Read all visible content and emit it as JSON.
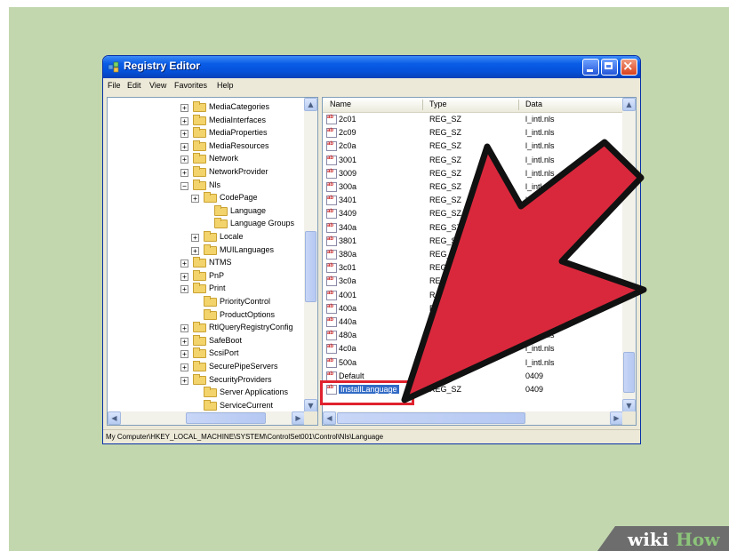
{
  "window": {
    "title": "Registry Editor",
    "menu": [
      "File",
      "Edit",
      "View",
      "Favorites",
      "Help"
    ]
  },
  "tree": {
    "items": [
      {
        "label": "MediaCategories",
        "expander": "+"
      },
      {
        "label": "MediaInterfaces",
        "expander": "+"
      },
      {
        "label": "MediaProperties",
        "expander": "+"
      },
      {
        "label": "MediaResources",
        "expander": "+"
      },
      {
        "label": "Network",
        "expander": "+"
      },
      {
        "label": "NetworkProvider",
        "expander": "+"
      },
      {
        "label": "Nls",
        "expander": "−"
      },
      {
        "label": "CodePage",
        "expander": "+"
      },
      {
        "label": "Language",
        "expander": ""
      },
      {
        "label": "Language Groups",
        "expander": ""
      },
      {
        "label": "Locale",
        "expander": "+"
      },
      {
        "label": "MUILanguages",
        "expander": "+"
      },
      {
        "label": "NTMS",
        "expander": "+"
      },
      {
        "label": "PnP",
        "expander": "+"
      },
      {
        "label": "Print",
        "expander": "+"
      },
      {
        "label": "PriorityControl",
        "expander": ""
      },
      {
        "label": "ProductOptions",
        "expander": ""
      },
      {
        "label": "RtlQueryRegistryConfig",
        "expander": "+"
      },
      {
        "label": "SafeBoot",
        "expander": "+"
      },
      {
        "label": "ScsiPort",
        "expander": "+"
      },
      {
        "label": "SecurePipeServers",
        "expander": "+"
      },
      {
        "label": "SecurityProviders",
        "expander": "+"
      },
      {
        "label": "Server Applications",
        "expander": ""
      },
      {
        "label": "ServiceCurrent",
        "expander": ""
      }
    ]
  },
  "list": {
    "columns": {
      "name": "Name",
      "type": "Type",
      "data": "Data"
    },
    "rows": [
      {
        "name": "2c01",
        "type": "REG_SZ",
        "data": "l_intl.nls"
      },
      {
        "name": "2c09",
        "type": "REG_SZ",
        "data": "l_intl.nls"
      },
      {
        "name": "2c0a",
        "type": "REG_SZ",
        "data": "l_intl.nls"
      },
      {
        "name": "3001",
        "type": "REG_SZ",
        "data": "l_intl.nls"
      },
      {
        "name": "3009",
        "type": "REG_SZ",
        "data": "l_intl.nls"
      },
      {
        "name": "300a",
        "type": "REG_SZ",
        "data": "l_intl.nls"
      },
      {
        "name": "3401",
        "type": "REG_SZ",
        "data": "l_intl"
      },
      {
        "name": "3409",
        "type": "REG_SZ",
        "data": ""
      },
      {
        "name": "340a",
        "type": "REG_SZ",
        "data": ""
      },
      {
        "name": "3801",
        "type": "REG_S",
        "data": ""
      },
      {
        "name": "380a",
        "type": "REG_",
        "data": ""
      },
      {
        "name": "3c01",
        "type": "REG",
        "data": ""
      },
      {
        "name": "3c0a",
        "type": "RE",
        "data": ""
      },
      {
        "name": "4001",
        "type": "R",
        "data": ""
      },
      {
        "name": "400a",
        "type": "R",
        "data": ""
      },
      {
        "name": "440a",
        "type": "",
        "data": ""
      },
      {
        "name": "480a",
        "type": "",
        "data": "l_intl.nls"
      },
      {
        "name": "4c0a",
        "type": "",
        "data": "l_intl.nls"
      },
      {
        "name": "500a",
        "type": "",
        "data": "l_intl.nls"
      },
      {
        "name": "Default",
        "type": "G_SZ",
        "data": "0409"
      },
      {
        "name": "InstallLanguage",
        "type": "REG_SZ",
        "data": "0409"
      }
    ]
  },
  "status": {
    "path": "My Computer\\HKEY_LOCAL_MACHINE\\SYSTEM\\ControlSet001\\Control\\Nls\\Language"
  },
  "watermark": {
    "wiki": "wiki",
    "how": "How"
  },
  "colors": {
    "background": "#c2d7ae",
    "titlebar": "#0a5ce6",
    "arrow_fill": "#d9283c",
    "highlight": "#e0222e",
    "selection": "#316ac5"
  }
}
